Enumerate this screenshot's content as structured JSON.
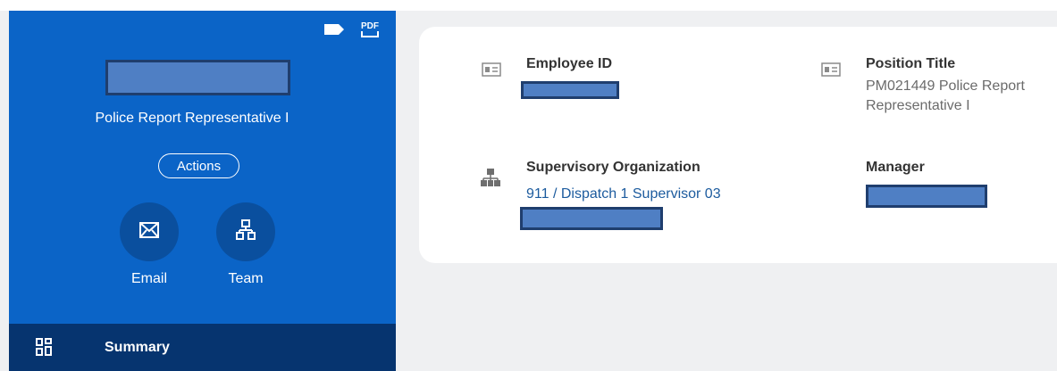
{
  "profile": {
    "position_line": "Police Report Representative I",
    "actions_label": "Actions",
    "quick_actions": [
      {
        "label": "Email",
        "icon": "envelope-icon"
      },
      {
        "label": "Team",
        "icon": "org-chart-icon"
      }
    ],
    "header_icons": [
      "tag-icon",
      "pdf-icon"
    ],
    "pdf_icon_text": "PDF"
  },
  "nav": {
    "summary_label": "Summary",
    "summary_icon": "dashboard-grid-icon"
  },
  "details": {
    "employee_id": {
      "title": "Employee ID",
      "icon": "id-card-icon"
    },
    "position_title": {
      "title": "Position Title",
      "value_line1": "PM021449 Police Report",
      "value_line2": "Representative I",
      "icon": "id-card-icon"
    },
    "supervisory_org": {
      "title": "Supervisory Organization",
      "value": "911 / Dispatch 1 Supervisor 03",
      "icon": "org-chart-icon"
    },
    "manager": {
      "title": "Manager"
    }
  },
  "colors": {
    "panel_blue": "#0b64c7",
    "panel_dark": "#06346f",
    "circle_blue": "#0a4f9e",
    "link_blue": "#1c5b9e",
    "redaction_fill": "#4f7fc4",
    "page_bg": "#eff0f2"
  }
}
